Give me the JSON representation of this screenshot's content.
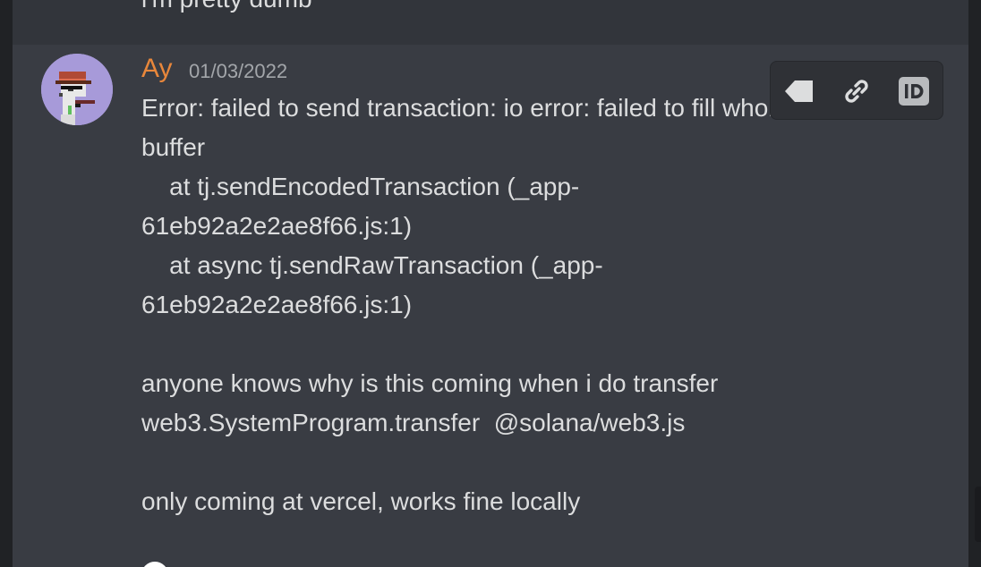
{
  "previous_message": {
    "text": "i'm pretty dumb"
  },
  "message": {
    "author": "Ay",
    "timestamp": "01/03/2022",
    "body": "Error: failed to send transaction: io error: failed to fill whole\nbuffer\n    at tj.sendEncodedTransaction (_app-\n61eb92a2e2ae8f66.js:1)\n    at async tj.sendRawTransaction (_app-\n61eb92a2e2ae8f66.js:1)\n\nanyone knows why is this coming when i do transfer\nweb3.SystemProgram.transfer  @solana/web3.js\n\nonly coming at vercel, works fine locally"
  },
  "toolbar": {
    "icons": [
      "tag-icon",
      "link-icon",
      "id-icon"
    ]
  },
  "colors": {
    "background": "#36393f",
    "hover_row": "#393c43",
    "author": "#e8873b",
    "text": "#dcddde",
    "timestamp": "#a3a6aa",
    "avatar_bg": "#a79ad9"
  }
}
